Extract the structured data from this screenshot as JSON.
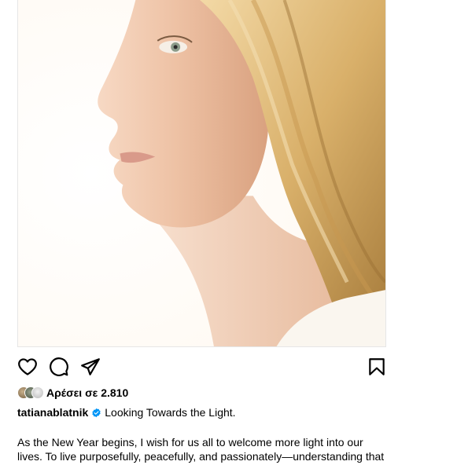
{
  "post": {
    "image": {
      "kind": "portrait-photo"
    },
    "actions": {
      "like_icon": "heart-icon",
      "comment_icon": "comment-icon",
      "share_icon": "paper-plane-icon",
      "save_icon": "bookmark-icon"
    },
    "likes": {
      "text": "Αρέσει σε 2.810"
    },
    "caption": {
      "username": "tatianablatnik",
      "verified": true,
      "verified_color": "#0095f6",
      "title": "Looking Towards the Light.",
      "lines": [
        "As the New Year begins, I wish for us all to welcome more light into our",
        "lives. To live purposefully, peacefully, and passionately—understanding that"
      ]
    }
  }
}
